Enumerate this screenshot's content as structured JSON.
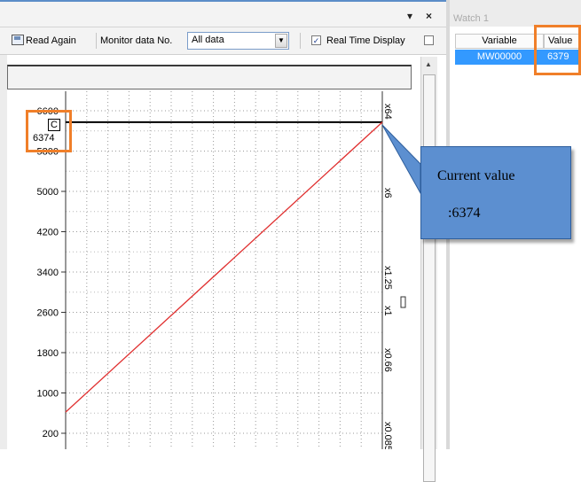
{
  "window": {
    "dropdown_glyph": "▾",
    "close_glyph": "×"
  },
  "toolbar": {
    "read_again_label": "Read Again",
    "monitor_label": "Monitor data No.",
    "monitor_value": "All data",
    "realtime_checked": true,
    "realtime_label": "Real Time Display"
  },
  "chart_data": {
    "type": "line",
    "y_ticks": [
      200,
      1000,
      1800,
      2600,
      3400,
      4200,
      5000,
      5800,
      6600
    ],
    "y_tick_labels": [
      "200",
      "1000",
      "1800",
      "2600",
      "3400",
      "4200",
      "5000",
      "5800",
      "6600"
    ],
    "ylim": [
      200,
      6700
    ],
    "x_range": [
      0,
      100
    ],
    "grid": true,
    "series": [
      {
        "x": [
          0,
          100
        ],
        "values": [
          620,
          6374
        ],
        "color": "#e03030"
      }
    ],
    "reference_value": 6374,
    "reference_color": "#000000",
    "scale_labels": [
      "x64",
      "x6",
      "x1.25",
      "x1",
      "x0.66",
      "x0.085"
    ],
    "marker_label": "C",
    "marker_value": "6374"
  },
  "callout": {
    "line1": "Current value",
    "line2": ":6374"
  },
  "watch": {
    "title": "Watch 1",
    "col_variable": "Variable",
    "col_value": "Value",
    "row_variable": "MW00000",
    "row_value": "6379"
  },
  "colors": {
    "highlight": "#f07f29",
    "callout_fill": "#5c8fd0",
    "selection": "#3399ff",
    "series": "#e03030"
  }
}
